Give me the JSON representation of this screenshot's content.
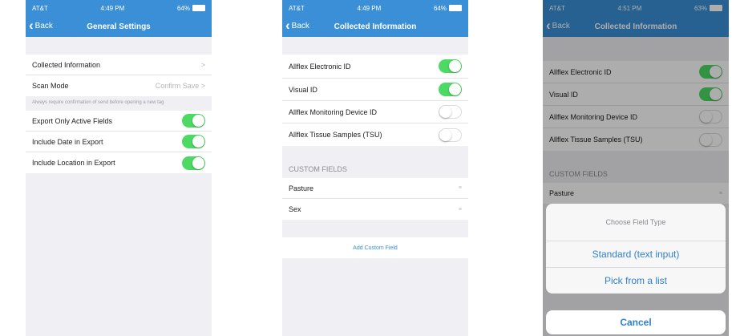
{
  "accent": "#3a8fd6",
  "toggle_on_color": "#4cd964",
  "phones": [
    {
      "status": {
        "carrier": "AT&T",
        "time": "4:49 PM",
        "battery": "64%"
      },
      "nav": {
        "back": "Back",
        "title": "General Settings"
      },
      "rows": [
        {
          "label": "Collected Information",
          "value": ">"
        },
        {
          "label": "Scan Mode",
          "value": "Confirm Save >"
        }
      ],
      "note": "Always require confirmation of send before opening a new tag",
      "toggles": [
        {
          "label": "Export Only Active Fields",
          "on": true
        },
        {
          "label": "Include Date in Export",
          "on": true
        },
        {
          "label": "Include Location in Export",
          "on": true
        }
      ]
    },
    {
      "status": {
        "carrier": "AT&T",
        "time": "4:49 PM",
        "battery": "64%"
      },
      "nav": {
        "back": "Back",
        "title": "Collected Information"
      },
      "toggles": [
        {
          "label": "Allflex Electronic ID",
          "on": true
        },
        {
          "label": "Visual ID",
          "on": true
        },
        {
          "label": "Allflex Monitoring Device ID",
          "on": false
        },
        {
          "label": "Allflex Tissue Samples (TSU)",
          "on": false
        }
      ],
      "section_header": "CUSTOM FIELDS",
      "custom_fields": [
        "Pasture",
        "Sex"
      ],
      "add_field": "Add Custom Field"
    },
    {
      "status": {
        "carrier": "AT&T",
        "time": "4:51 PM",
        "battery": "63%"
      },
      "nav": {
        "back": "Back",
        "title": "Collected Information"
      },
      "toggles": [
        {
          "label": "Allflex Electronic ID",
          "on": true
        },
        {
          "label": "Visual ID",
          "on": true
        },
        {
          "label": "Allflex Monitoring Device ID",
          "on": false
        },
        {
          "label": "Allflex Tissue Samples (TSU)",
          "on": false
        }
      ],
      "section_header": "CUSTOM FIELDS",
      "custom_fields": [
        "Pasture"
      ],
      "action_sheet": {
        "title": "Choose Field Type",
        "options": [
          "Standard (text input)",
          "Pick from a list"
        ],
        "cancel": "Cancel"
      }
    }
  ]
}
